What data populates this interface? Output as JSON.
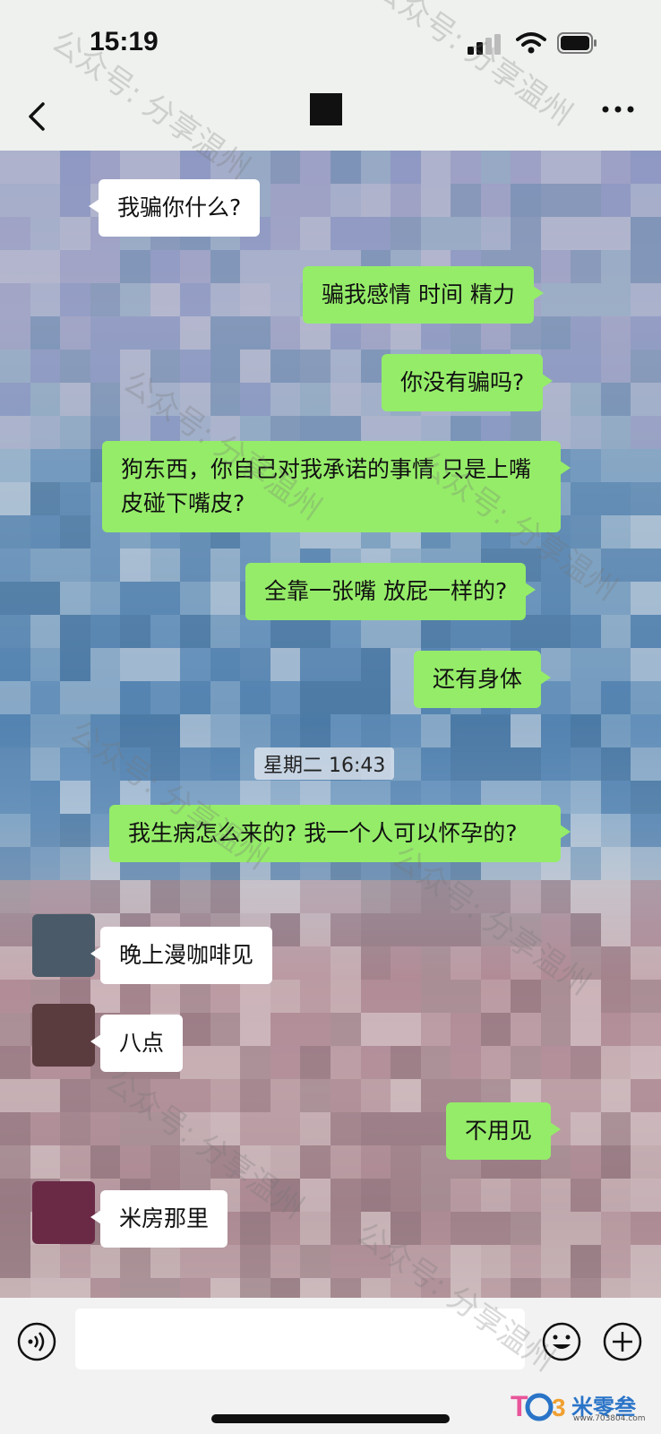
{
  "status_bar": {
    "time": "15:19"
  },
  "nav": {
    "back": "‹",
    "more": "···"
  },
  "messages": [
    {
      "side": "left",
      "text": "我骗你什么?"
    },
    {
      "side": "right",
      "text": "骗我感情 时间 精力"
    },
    {
      "side": "right",
      "text": "你没有骗吗?"
    },
    {
      "side": "right",
      "text": "狗东西，你自己对我承诺的事情 只是上嘴皮碰下嘴皮?"
    },
    {
      "side": "right",
      "text": "全靠一张嘴 放屁一样的?"
    },
    {
      "side": "right",
      "text": "还有身体"
    },
    {
      "side": "right",
      "text": "我生病怎么来的? 我一个人可以怀孕的?"
    },
    {
      "side": "left",
      "text": "晚上漫咖啡见"
    },
    {
      "side": "left",
      "text": "八点"
    },
    {
      "side": "right",
      "text": "不用见"
    },
    {
      "side": "left",
      "text": "米房那里"
    }
  ],
  "timestamp": "星期二 16:43",
  "watermark": "公众号: 分享温州",
  "site_logo": {
    "text": "米零叁",
    "url": "www.703804.com"
  },
  "colors": {
    "sent_bubble": "#95ec69",
    "received_bubble": "#ffffff"
  },
  "icons": [
    "chevron-left-icon",
    "more-icon",
    "voice-icon",
    "emoji-icon",
    "plus-icon",
    "signal-icon",
    "wifi-icon",
    "battery-icon"
  ]
}
